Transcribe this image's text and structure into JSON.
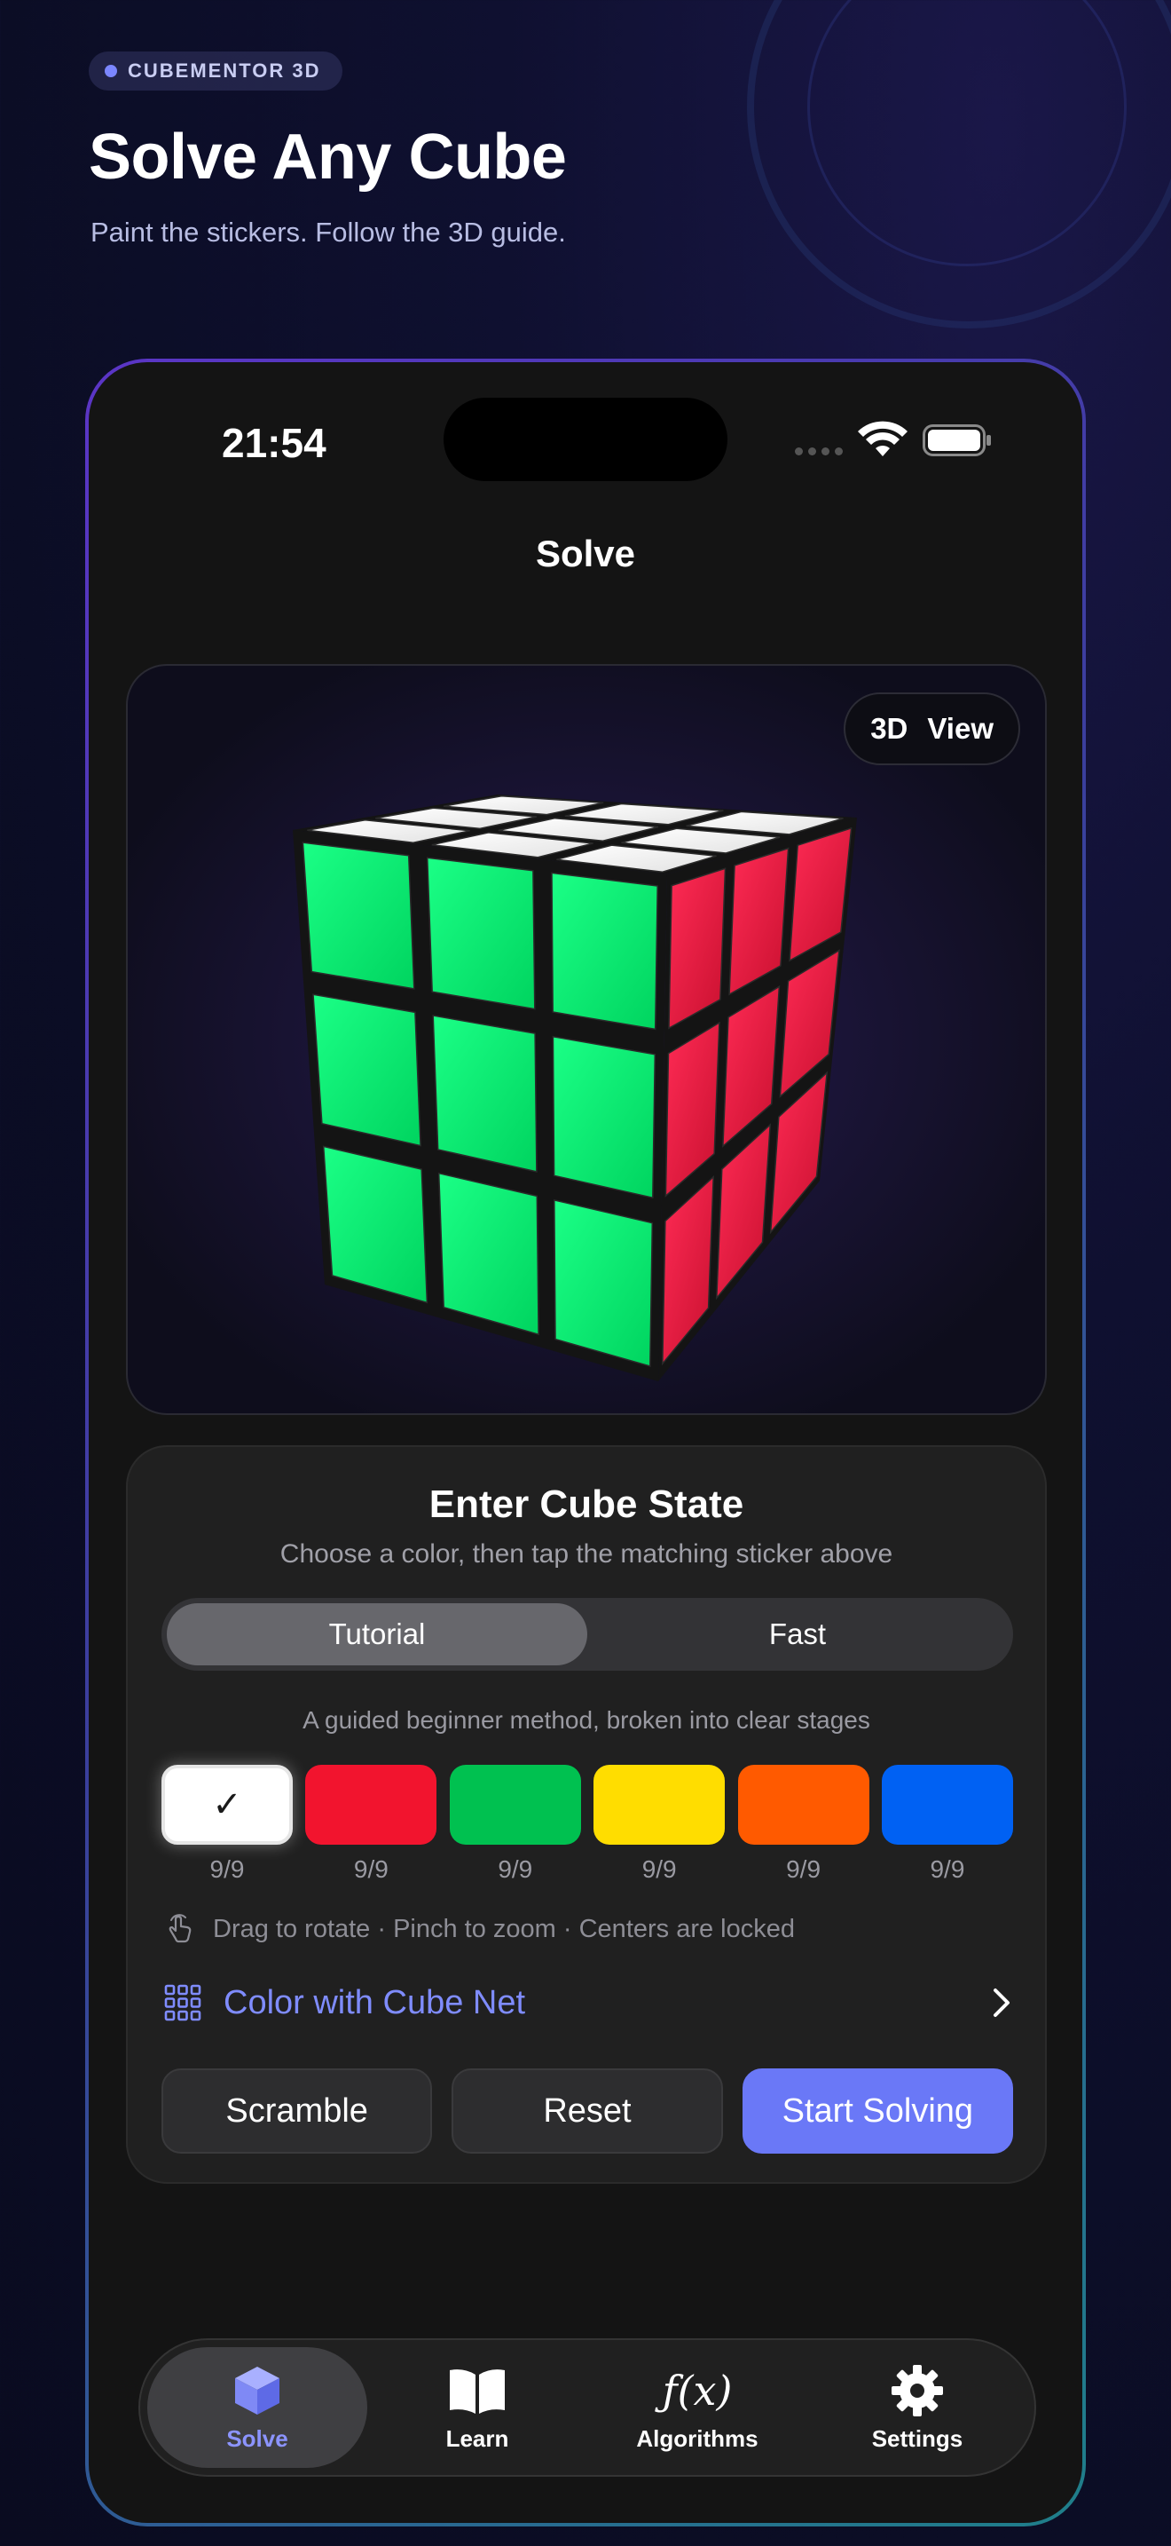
{
  "brand": {
    "label": "CUBEMENTOR 3D"
  },
  "hero": {
    "title": "Solve Any Cube",
    "subtitle": "Paint the stickers. Follow the 3D guide."
  },
  "status_bar": {
    "time": "21:54"
  },
  "nav": {
    "title": "Solve"
  },
  "viewer": {
    "view_label_a": "3D",
    "view_label_b": "View"
  },
  "cube_state": {
    "title": "Enter Cube State",
    "subtitle": "Choose a color, then tap the matching sticker above",
    "modes": [
      {
        "label": "Tutorial",
        "active": true
      },
      {
        "label": "Fast",
        "active": false
      }
    ],
    "method_description": "A guided beginner method, broken into clear stages",
    "colors": [
      {
        "name": "white",
        "hex": "#ffffff",
        "count": "9/9",
        "selected": true,
        "mark": "✓"
      },
      {
        "name": "red",
        "hex": "#f2142e",
        "count": "9/9",
        "selected": false
      },
      {
        "name": "green",
        "hex": "#00c150",
        "count": "9/9",
        "selected": false
      },
      {
        "name": "yellow",
        "hex": "#ffdd00",
        "count": "9/9",
        "selected": false
      },
      {
        "name": "orange",
        "hex": "#ff5a00",
        "count": "9/9",
        "selected": false
      },
      {
        "name": "blue",
        "hex": "#0061f3",
        "count": "9/9",
        "selected": false
      }
    ],
    "hint": "Drag to rotate · Pinch to zoom · Centers are locked",
    "cube_net_link": "Color with Cube Net",
    "buttons": {
      "scramble": "Scramble",
      "reset": "Reset",
      "start": "Start Solving"
    }
  },
  "tabbar": {
    "tabs": [
      {
        "label": "Solve",
        "icon": "cube-icon",
        "active": true
      },
      {
        "label": "Learn",
        "icon": "book-icon",
        "active": false
      },
      {
        "label": "Algorithms",
        "icon": "function-icon",
        "glyph": "ƒ(x)",
        "active": false
      },
      {
        "label": "Settings",
        "icon": "gear-icon",
        "active": false
      }
    ]
  },
  "colors": {
    "accent": "#6a78f7",
    "accent_text": "#7f8cff",
    "face_top": "#f4f4f4",
    "face_left": "#0bef74",
    "face_right": "#f0183f"
  }
}
